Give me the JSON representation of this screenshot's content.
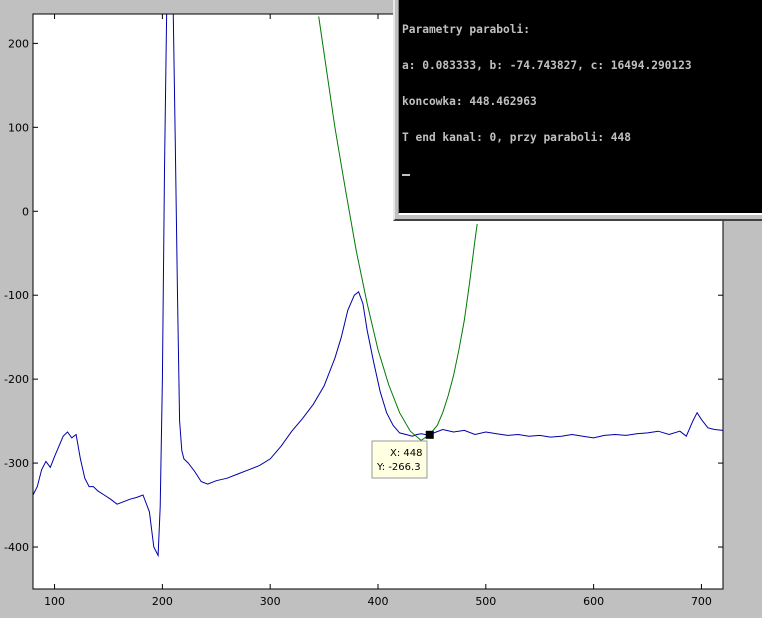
{
  "console": {
    "lines": [
      "Parametry paraboli:",
      "a: 0.083333, b: -74.743827, c: 16494.290123",
      "koncowka: 448.462963",
      "T end kanal: 0, przy paraboli: 448"
    ]
  },
  "datatip": {
    "x_label": "X: 448",
    "y_label": "Y: -266.3"
  },
  "colors": {
    "signal": "#0000aa",
    "parabola": "#007a00",
    "axes_bg": "#ffffff",
    "figure_bg": "#c0c0c0"
  },
  "chart_data": {
    "type": "line",
    "title": "",
    "xlabel": "",
    "ylabel": "",
    "xlim": [
      80,
      720
    ],
    "ylim": [
      -450,
      235
    ],
    "xticks": [
      100,
      200,
      300,
      400,
      500,
      600,
      700
    ],
    "yticks": [
      200,
      100,
      0,
      -100,
      -200,
      -300,
      -400
    ],
    "series": [
      {
        "type": "line",
        "color": "#0000aa",
        "x": [
          80,
          84,
          88,
          92,
          96,
          100,
          104,
          108,
          112,
          116,
          120,
          124,
          128,
          132,
          136,
          140,
          146,
          152,
          158,
          164,
          170,
          176,
          182,
          188,
          192,
          196,
          198,
          200,
          202,
          204,
          206,
          208,
          210,
          212,
          214,
          216,
          218,
          220,
          224,
          230,
          236,
          242,
          250,
          260,
          270,
          280,
          290,
          300,
          310,
          320,
          330,
          340,
          350,
          360,
          366,
          372,
          378,
          382,
          386,
          390,
          396,
          402,
          408,
          414,
          420,
          426,
          432,
          436,
          440,
          444,
          448,
          454,
          460,
          470,
          480,
          490,
          500,
          510,
          520,
          530,
          540,
          550,
          560,
          570,
          580,
          590,
          600,
          610,
          620,
          630,
          640,
          650,
          660,
          670,
          680,
          686,
          692,
          696,
          700,
          706,
          712,
          720
        ],
        "y": [
          -338,
          -328,
          -308,
          -298,
          -305,
          -292,
          -280,
          -268,
          -263,
          -270,
          -266,
          -295,
          -318,
          -328,
          -328,
          -333,
          -338,
          -343,
          -349,
          -346,
          -343,
          -341,
          -338,
          -358,
          -400,
          -410,
          -352,
          -200,
          50,
          240,
          240,
          240,
          240,
          80,
          -100,
          -250,
          -285,
          -295,
          -300,
          -310,
          -322,
          -325,
          -321,
          -318,
          -313,
          -308,
          -303,
          -295,
          -280,
          -262,
          -247,
          -230,
          -208,
          -175,
          -150,
          -118,
          -100,
          -96,
          -110,
          -142,
          -180,
          -215,
          -240,
          -255,
          -264,
          -266,
          -268,
          -266,
          -265,
          -266,
          -266,
          -263,
          -260,
          -263,
          -261,
          -266,
          -263,
          -265,
          -267,
          -266,
          -268,
          -267,
          -269,
          -268,
          -266,
          -268,
          -270,
          -267,
          -266,
          -267,
          -265,
          -264,
          -262,
          -266,
          -262,
          -268,
          -250,
          -240,
          -248,
          -258,
          -260,
          -261
        ]
      },
      {
        "type": "line",
        "color": "#007a00",
        "x": [
          345,
          360,
          370,
          380,
          390,
          400,
          410,
          420,
          430,
          440,
          448,
          455,
          460,
          465,
          470,
          475,
          480,
          485,
          490,
          492
        ],
        "y": [
          232,
          100,
          24,
          -48,
          -110,
          -165,
          -207,
          -240,
          -262,
          -273,
          -266,
          -255,
          -240,
          -220,
          -196,
          -165,
          -130,
          -85,
          -34,
          -15
        ]
      }
    ],
    "marker": {
      "x": 448,
      "y": -266.3
    },
    "annotations": [
      "Parametry paraboli:",
      "a: 0.083333, b: -74.743827, c: 16494.290123",
      "koncowka: 448.462963",
      "T end kanal: 0, przy paraboli: 448"
    ]
  }
}
